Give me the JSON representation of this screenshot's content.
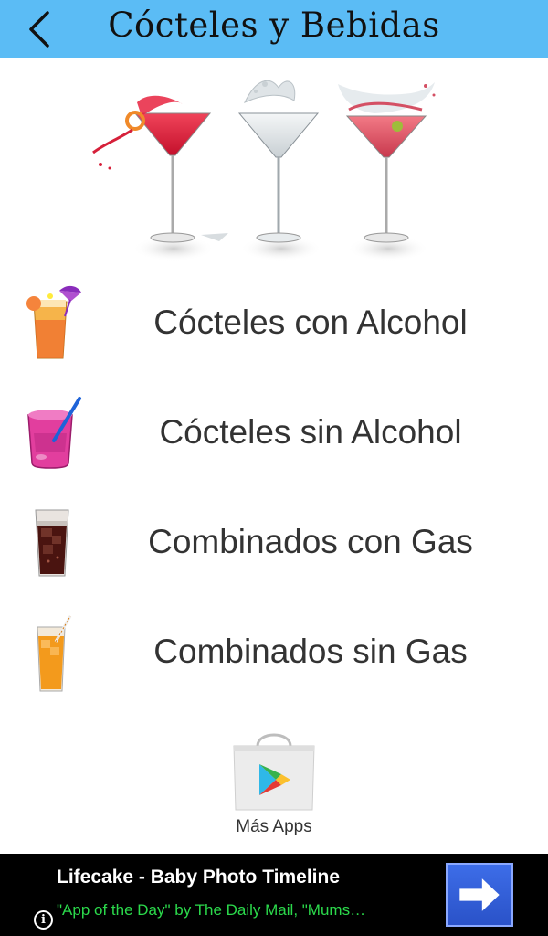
{
  "header": {
    "title": "Cócteles y Bebidas",
    "back_icon": "chevron-left-icon",
    "background": "#5bbcf5"
  },
  "hero": {
    "image": "three-martini-glasses-splash"
  },
  "menu": {
    "items": [
      {
        "label": "Cócteles con Alcohol",
        "icon": "tropical-cocktail-icon"
      },
      {
        "label": "Cócteles sin Alcohol",
        "icon": "pink-drink-straw-icon"
      },
      {
        "label": "Combinados con Gas",
        "icon": "cola-glass-icon"
      },
      {
        "label": "Combinados sin Gas",
        "icon": "orange-juice-icon"
      }
    ]
  },
  "more_apps": {
    "label": "Más Apps",
    "icon": "play-store-bag-icon"
  },
  "ad": {
    "title": "Lifecake - Baby Photo Timeline",
    "subtitle": "\"App of the Day\" by The Daily Mail, \"Mums…",
    "info_glyph": "i",
    "button_icon": "arrow-right-icon",
    "accent": "#2bd94b"
  }
}
